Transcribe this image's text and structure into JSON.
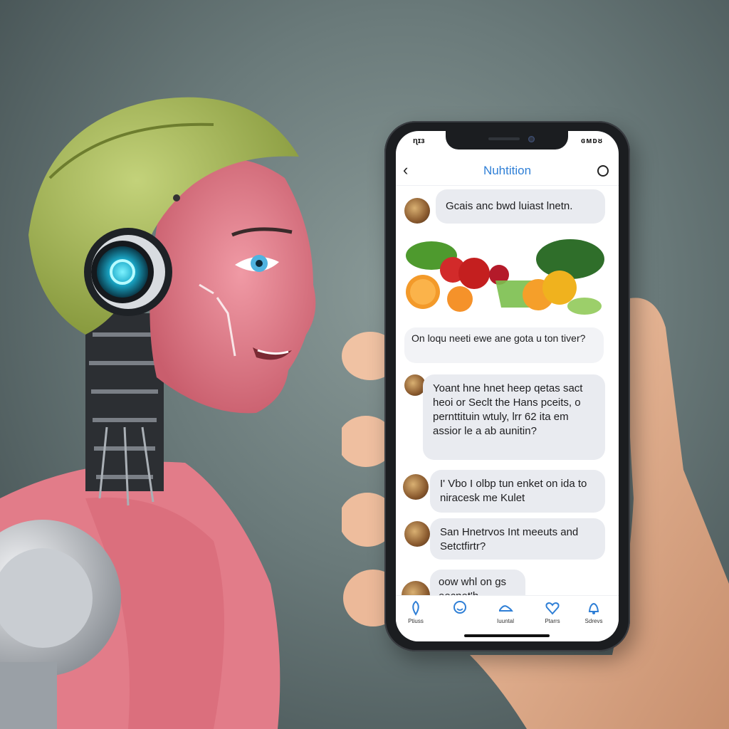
{
  "phone": {
    "status_time": "ɳɪɜ",
    "status_icons": "ɞᴍᴅᴕ",
    "header_title": "Nuhtition"
  },
  "messages": [
    {
      "text": "Gcais anc bwd luiast lnetn."
    },
    {
      "text": "On loqu neeti ewe ane gota u ton tiver?"
    },
    {
      "text": "Yoant hne hnet heep qetas sact heoi or Seclt the Hans pceits, o pernttituin wtuly, lrr 62 ita em assior le a ab aunitin?"
    },
    {
      "text": "I' Vbo I olbp tun enket on ida to niracesk me Kulet"
    },
    {
      "text": "San Hnetrvos Int meeuts and Setctfirtr?"
    },
    {
      "text": "oow whl on gs eecnet'h.."
    }
  ],
  "tabs": [
    {
      "label": "Ptiuss",
      "icon": "pin-icon"
    },
    {
      "label": "",
      "icon": "face-icon"
    },
    {
      "label": "Iuuntal",
      "icon": "shoe-icon"
    },
    {
      "label": "Ptarrs",
      "icon": "heart-icon"
    },
    {
      "label": "Sdrevs",
      "icon": "bell-icon"
    }
  ],
  "colors": {
    "accent": "#2f7fd6",
    "helmet": "#a8bb5a",
    "body": "#e07f8c"
  }
}
